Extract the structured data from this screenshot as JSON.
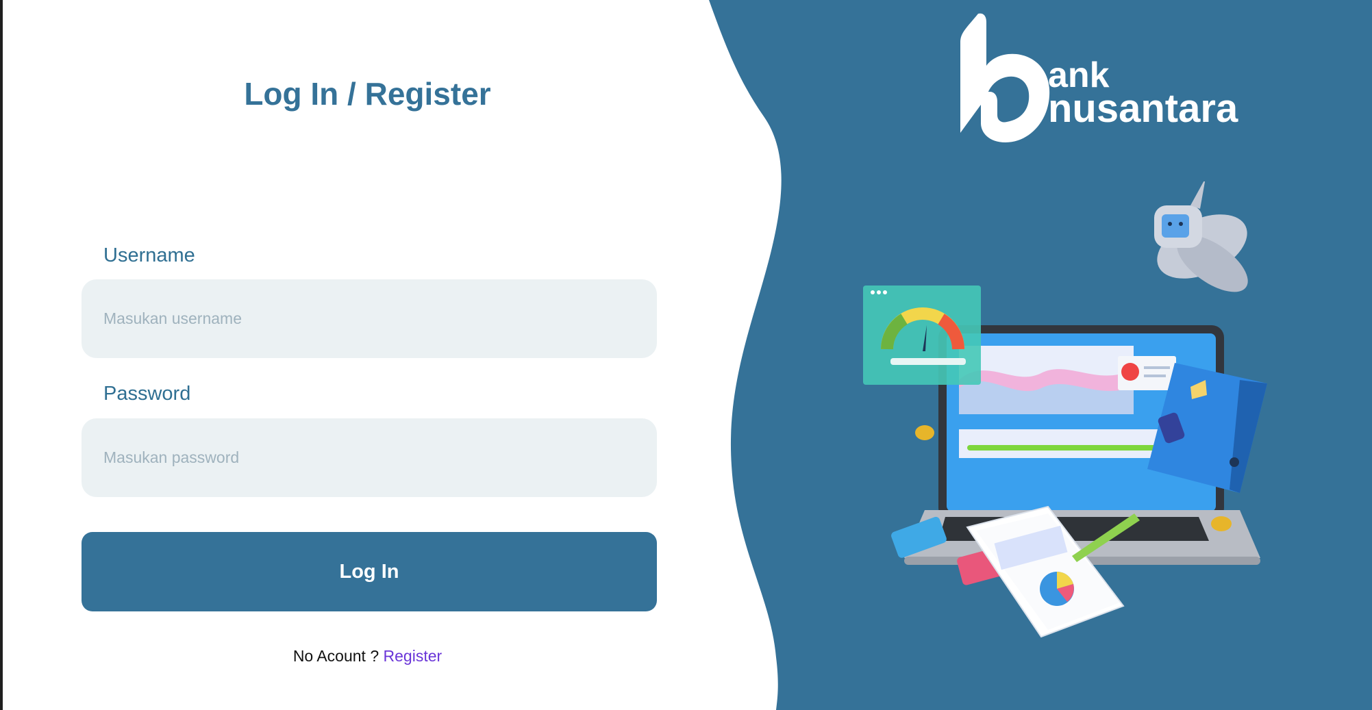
{
  "login": {
    "title": "Log In / Register",
    "username_label": "Username",
    "username_placeholder": "Masukan username",
    "username_value": "",
    "password_label": "Password",
    "password_placeholder": "Masukan password",
    "password_value": "",
    "login_button_label": "Log In",
    "no_account_text": "No Acount ?",
    "register_link_label": "Register"
  },
  "brand": {
    "logo_line1": "ank",
    "logo_line2": "nusantara"
  },
  "illustration": {
    "description_icon": "finance-laptop-illustration"
  },
  "colors": {
    "primary": "#357298",
    "input_bg": "#ebf1f3",
    "link": "#6a35d8",
    "placeholder": "#9fb2bd"
  }
}
